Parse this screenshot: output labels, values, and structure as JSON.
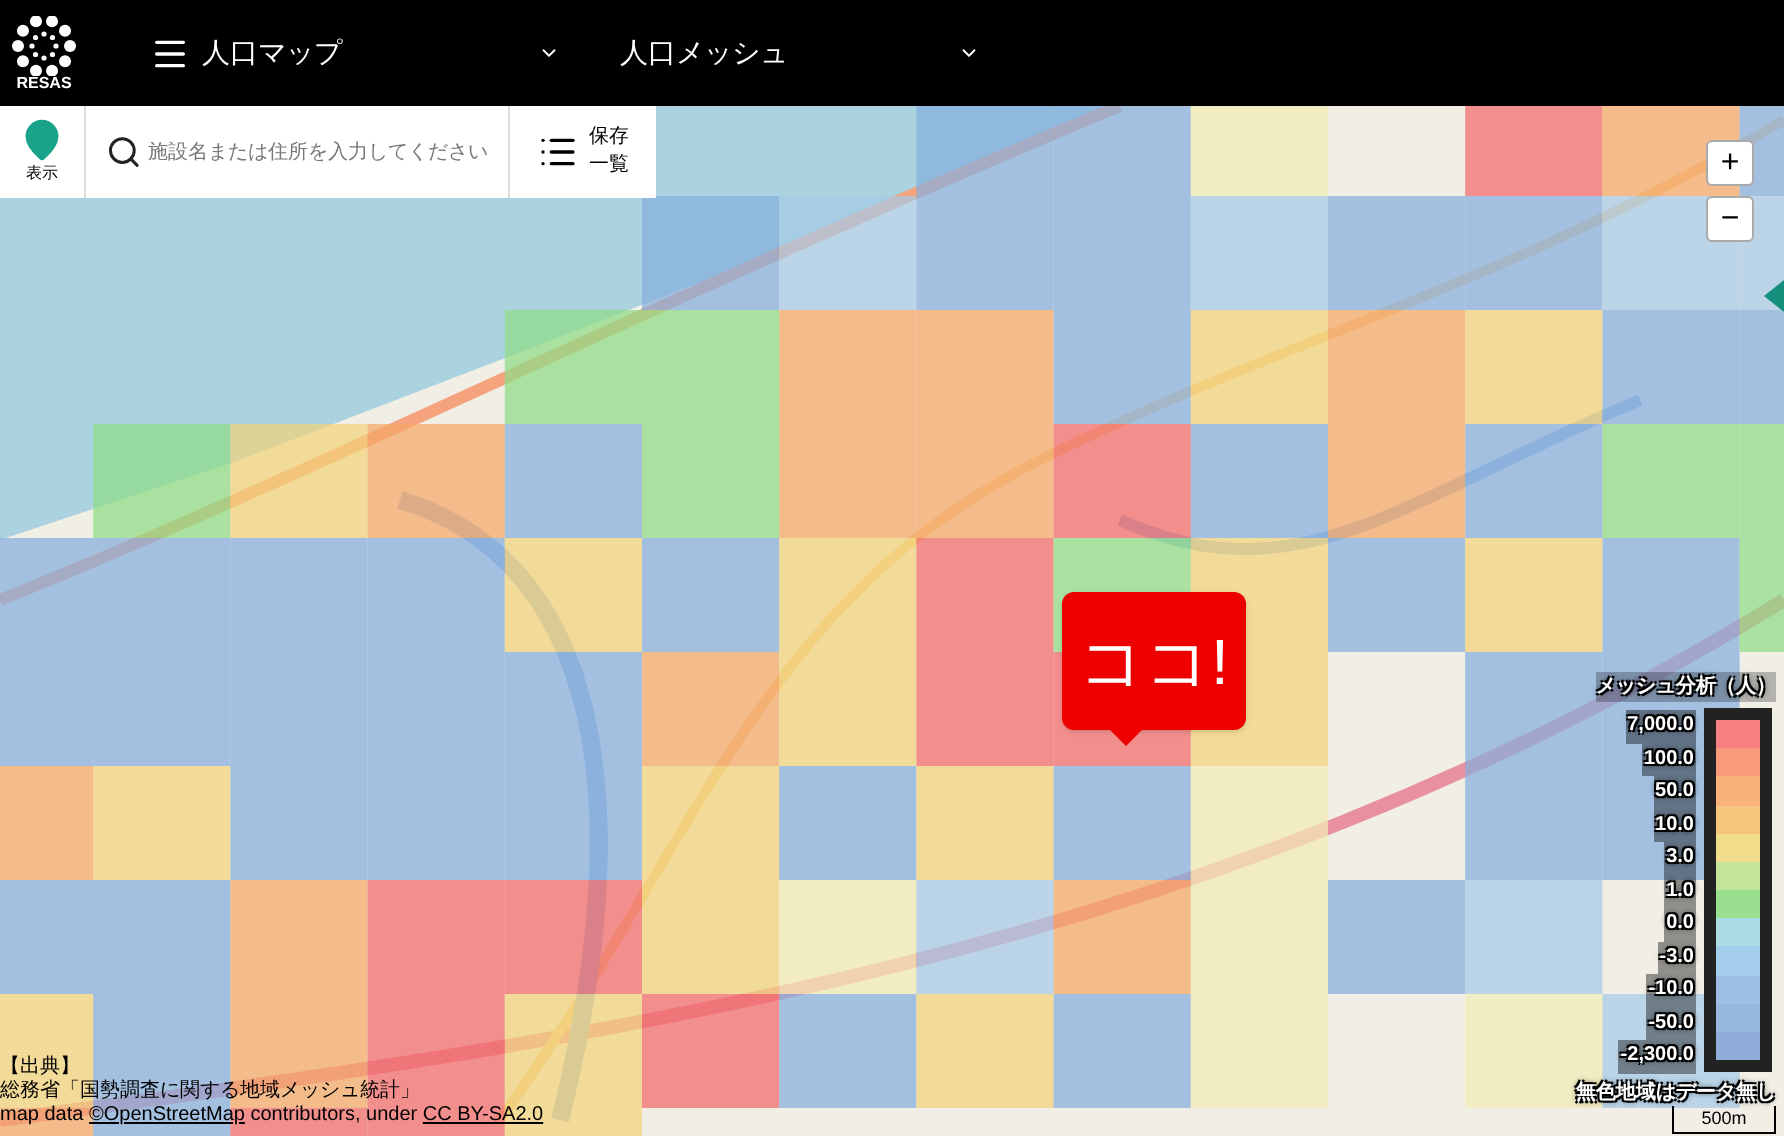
{
  "header": {
    "logo_text": "RESAS",
    "menus": [
      {
        "label": "人口マップ"
      },
      {
        "label": "人口メッシュ"
      }
    ]
  },
  "toolbar": {
    "show_label": "表示",
    "search": {
      "placeholder": "施設名または住所を入力してください"
    },
    "saved_lines": [
      "保存",
      "一覧"
    ]
  },
  "map": {
    "callout": "ココ!",
    "zoom_in": "+",
    "zoom_out": "−"
  },
  "legend": {
    "title": "メッシュ分析（人）",
    "labels": [
      "7,000.0",
      "100.0",
      "50.0",
      "10.0",
      "3.0",
      "1.0",
      "0.0",
      "-3.0",
      "-10.0",
      "-50.0",
      "-2,300.0"
    ],
    "note": "無色地域はデータ無し",
    "scale": "500m"
  },
  "attribution": {
    "source_lines": [
      "【出典】",
      "総務省「国勢調査に関する地域メッシュ統計」"
    ],
    "credit_prefix": "map data ",
    "credit_link": "©OpenStreetMap",
    "credit_middle": " contributors, under ",
    "license_link": "CC BY-SA2.0"
  }
}
